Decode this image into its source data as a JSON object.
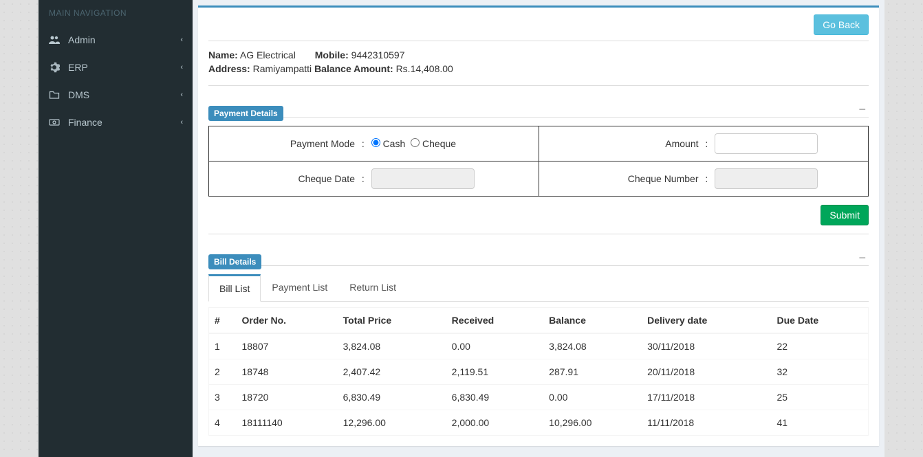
{
  "sidebar": {
    "section_title": "MAIN NAVIGATION",
    "items": [
      {
        "label": "Admin",
        "icon": "users-icon"
      },
      {
        "label": "ERP",
        "icon": "gear-icon"
      },
      {
        "label": "DMS",
        "icon": "folder-icon"
      },
      {
        "label": "Finance",
        "icon": "money-icon"
      }
    ]
  },
  "header": {
    "go_back_label": "Go Back"
  },
  "customer": {
    "name_label": "Name:",
    "name_value": "AG Electrical",
    "mobile_label": "Mobile:",
    "mobile_value": "9442310597",
    "address_label": "Address:",
    "address_value": "Ramiyampatti",
    "balance_label": "Balance Amount:",
    "balance_value": "Rs.14,408.00"
  },
  "payment": {
    "section_title": "Payment Details",
    "mode_label": "Payment Mode",
    "cash_label": "Cash",
    "cheque_label": "Cheque",
    "amount_label": "Amount",
    "cheque_date_label": "Cheque Date",
    "cheque_number_label": "Cheque Number",
    "submit_label": "Submit",
    "mode_selected": "cash"
  },
  "bill": {
    "section_title": "Bill Details",
    "tabs": [
      {
        "label": "Bill List",
        "active": true
      },
      {
        "label": "Payment List",
        "active": false
      },
      {
        "label": "Return List",
        "active": false
      }
    ],
    "columns": {
      "idx": "#",
      "order_no": "Order No.",
      "total_price": "Total Price",
      "received": "Received",
      "balance": "Balance",
      "delivery_date": "Delivery date",
      "due_date": "Due Date"
    },
    "rows": [
      {
        "idx": "1",
        "order_no": "18807",
        "total_price": "3,824.08",
        "received": "0.00",
        "balance": "3,824.08",
        "delivery_date": "30/11/2018",
        "due_date": "22"
      },
      {
        "idx": "2",
        "order_no": "18748",
        "total_price": "2,407.42",
        "received": "2,119.51",
        "balance": "287.91",
        "delivery_date": "20/11/2018",
        "due_date": "32"
      },
      {
        "idx": "3",
        "order_no": "18720",
        "total_price": "6,830.49",
        "received": "6,830.49",
        "balance": "0.00",
        "delivery_date": "17/11/2018",
        "due_date": "25"
      },
      {
        "idx": "4",
        "order_no": "18111140",
        "total_price": "12,296.00",
        "received": "2,000.00",
        "balance": "10,296.00",
        "delivery_date": "11/11/2018",
        "due_date": "41"
      }
    ]
  }
}
